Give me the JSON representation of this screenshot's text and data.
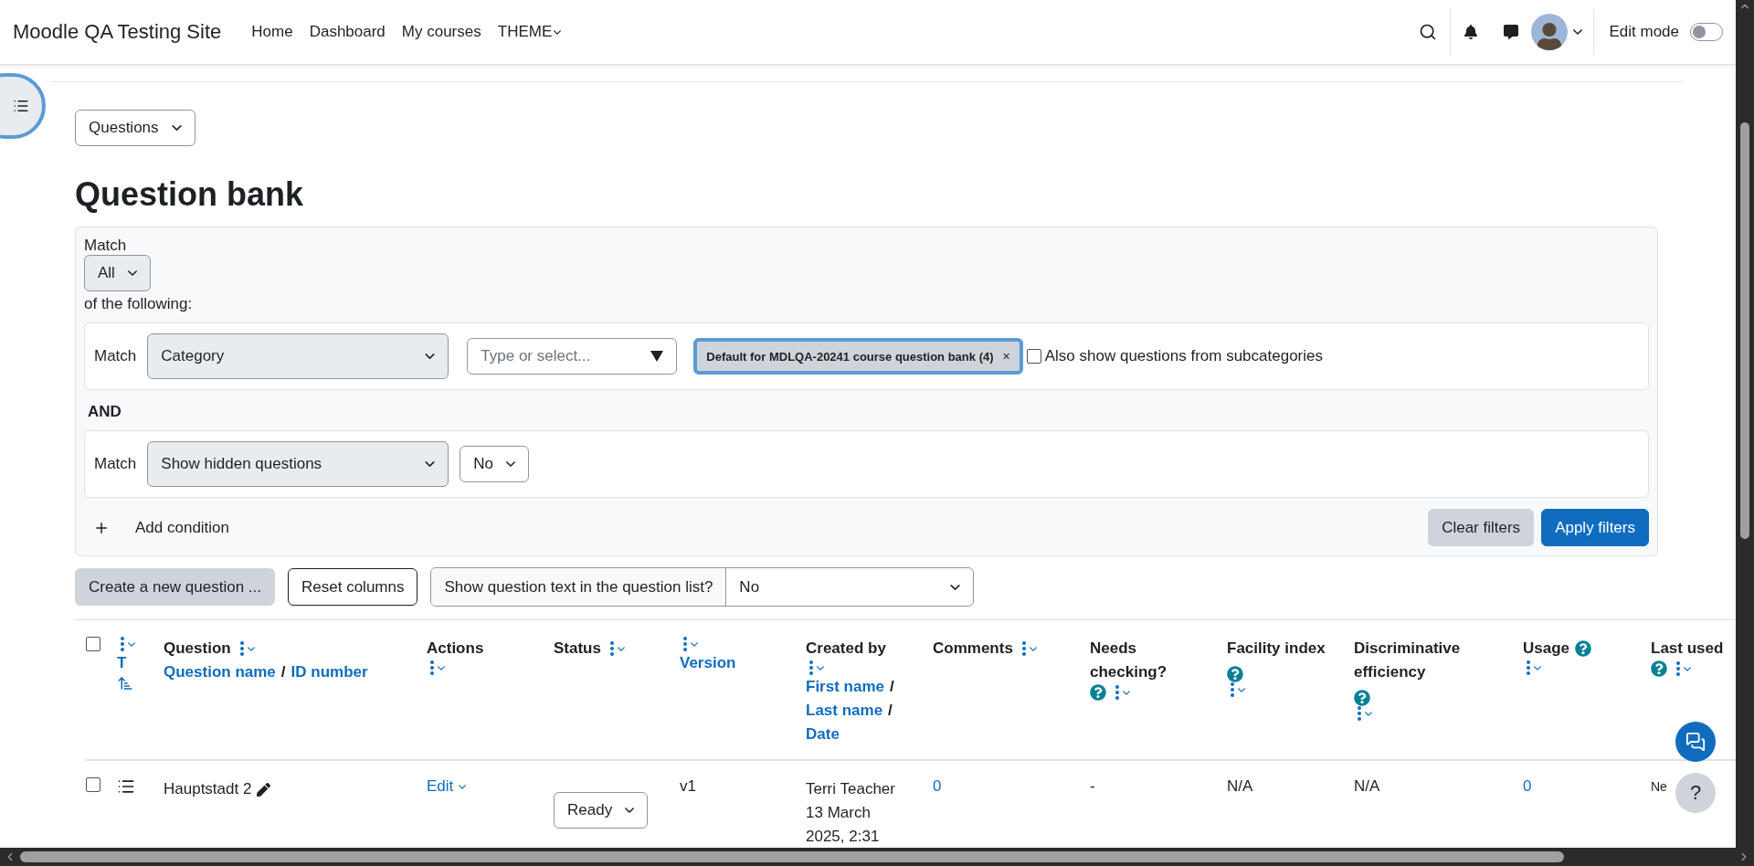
{
  "navbar": {
    "site_name": "Moodle QA Testing Site",
    "links": [
      {
        "label": "Home",
        "has_menu": false
      },
      {
        "label": "Dashboard",
        "has_menu": false
      },
      {
        "label": "My courses",
        "has_menu": false
      },
      {
        "label": "THEME",
        "has_menu": true
      }
    ],
    "edit_mode": {
      "label": "Edit mode",
      "on": false
    }
  },
  "page_menu": {
    "value": "Questions"
  },
  "heading": "Question bank",
  "filter": {
    "match_label": "Match",
    "match_value": "All",
    "following": "of the following:",
    "conditions": [
      {
        "kind": "category",
        "match_label": "Match",
        "field": "Category",
        "placeholder": "Type or select...",
        "chip": "Default for MDLQA-20241 course question bank (4)",
        "chip_close": "×",
        "option": {
          "label": "Also show questions from subcategories",
          "checked": false
        }
      },
      {
        "kind": "select",
        "match_label": "Match",
        "field": "Show hidden questions",
        "value": "No"
      }
    ],
    "joiner": "AND",
    "add_condition": "Add condition",
    "clear": "Clear filters",
    "apply": "Apply filters"
  },
  "toolbar": {
    "create": "Create a new question ...",
    "reset": "Reset columns",
    "show_text_label": "Show question text in the question list?",
    "show_text_value": "No"
  },
  "table": {
    "select_all": {
      "checked": false
    },
    "columns": [
      {
        "lines": [
          [
            {
              "kind": "menu"
            }
          ],
          [
            {
              "kind": "sort",
              "text": "T"
            }
          ],
          [
            {
              "kind": "sort_dir"
            }
          ]
        ]
      },
      {
        "lines": [
          [
            {
              "kind": "title",
              "text": "Question"
            },
            {
              "kind": "menu"
            }
          ],
          [
            {
              "kind": "sort",
              "text": "Question name"
            },
            {
              "kind": "sep",
              "text": "/"
            },
            {
              "kind": "sort",
              "text": "ID number"
            }
          ]
        ]
      },
      {
        "lines": [
          [
            {
              "kind": "title",
              "text": "Actions"
            }
          ],
          [
            {
              "kind": "menu"
            }
          ]
        ]
      },
      {
        "lines": [
          [
            {
              "kind": "title",
              "text": "Status"
            },
            {
              "kind": "menu"
            }
          ]
        ]
      },
      {
        "lines": [
          [
            {
              "kind": "menu"
            }
          ],
          [
            {
              "kind": "sort",
              "text": "Version"
            }
          ]
        ]
      },
      {
        "lines": [
          [
            {
              "kind": "title",
              "text": "Created by"
            }
          ],
          [
            {
              "kind": "menu"
            }
          ],
          [
            {
              "kind": "sort",
              "text": "First name"
            },
            {
              "kind": "sep",
              "text": "/"
            }
          ],
          [
            {
              "kind": "sort",
              "text": "Last name"
            },
            {
              "kind": "sep",
              "text": "/"
            }
          ],
          [
            {
              "kind": "sort",
              "text": "Date"
            }
          ]
        ]
      },
      {
        "lines": [
          [
            {
              "kind": "title",
              "text": "Comments"
            },
            {
              "kind": "menu"
            }
          ]
        ]
      },
      {
        "lines": [
          [
            {
              "kind": "title",
              "text": "Needs checking?"
            }
          ],
          [
            {
              "kind": "help"
            },
            {
              "kind": "menu"
            }
          ]
        ]
      },
      {
        "lines": [
          [
            {
              "kind": "title",
              "text": "Facility index"
            },
            {
              "kind": "help"
            }
          ],
          [
            {
              "kind": "menu"
            }
          ]
        ]
      },
      {
        "lines": [
          [
            {
              "kind": "title",
              "text": "Discriminative efficiency"
            },
            {
              "kind": "help"
            }
          ],
          [
            {
              "kind": "menu"
            }
          ]
        ]
      },
      {
        "lines": [
          [
            {
              "kind": "title",
              "text": "Usage"
            },
            {
              "kind": "help"
            }
          ],
          [
            {
              "kind": "menu"
            }
          ]
        ]
      },
      {
        "lines": [
          [
            {
              "kind": "title",
              "text": "Last used"
            }
          ],
          [
            {
              "kind": "help"
            },
            {
              "kind": "menu"
            }
          ]
        ]
      }
    ],
    "rows": [
      {
        "checked": false,
        "name": "Hauptstadt 2",
        "action": "Edit",
        "status": "Ready",
        "version": "v1",
        "created": [
          "Terri Teacher",
          "13 March 2025, 2:31"
        ],
        "comments": "0",
        "needs_checking": "-",
        "facility": "N/A",
        "discriminative": "N/A",
        "usage": "0",
        "last_used": "Ne"
      }
    ]
  },
  "help_button": "?"
}
